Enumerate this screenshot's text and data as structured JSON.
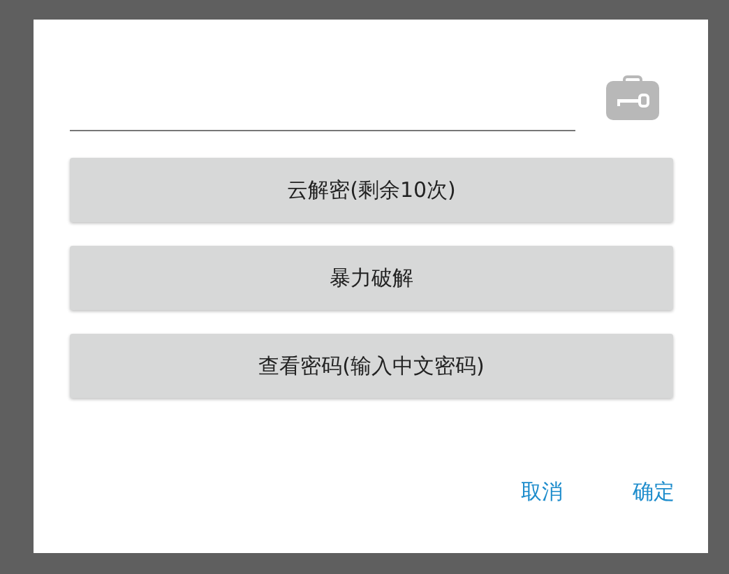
{
  "options": [
    "云解密(剩余10次)",
    "暴力破解",
    "查看密码(输入中文密码)"
  ],
  "actions": [
    "取消",
    "确定"
  ]
}
